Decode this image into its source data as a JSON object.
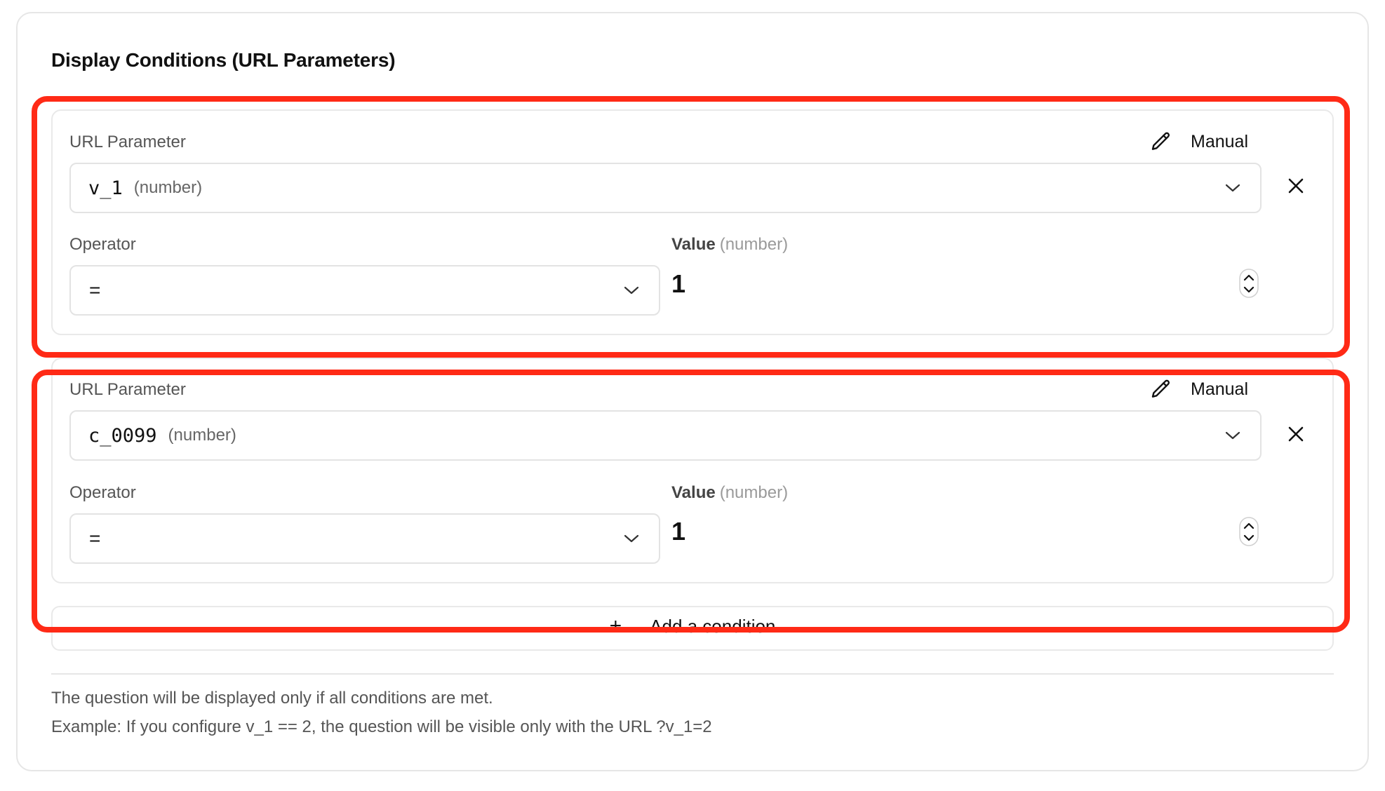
{
  "section": {
    "title": "Display Conditions (URL Parameters)"
  },
  "conditions": [
    {
      "param_label": "URL Parameter",
      "manual_label": "Manual",
      "param_name": "v_1",
      "param_type": "(number)",
      "operator_label": "Operator",
      "operator_value": "=",
      "value_label": "Value",
      "value_type": "(number)",
      "value": "1"
    },
    {
      "param_label": "URL Parameter",
      "manual_label": "Manual",
      "param_name": "c_0099",
      "param_type": "(number)",
      "operator_label": "Operator",
      "operator_value": "=",
      "value_label": "Value",
      "value_type": "(number)",
      "value": "1"
    }
  ],
  "add_condition": {
    "plus": "+",
    "label": "Add a condition"
  },
  "help": {
    "line1": "The question will be displayed only if all conditions are met.",
    "line2": "Example: If you configure v_1 == 2, the question will be visible only with the URL ?v_1=2"
  },
  "colors": {
    "highlight": "#ff2a16",
    "border": "#e6e6e6"
  },
  "icons": [
    "pencil-icon",
    "chevron-down-icon",
    "close-icon",
    "stepper-icon",
    "plus-icon"
  ]
}
